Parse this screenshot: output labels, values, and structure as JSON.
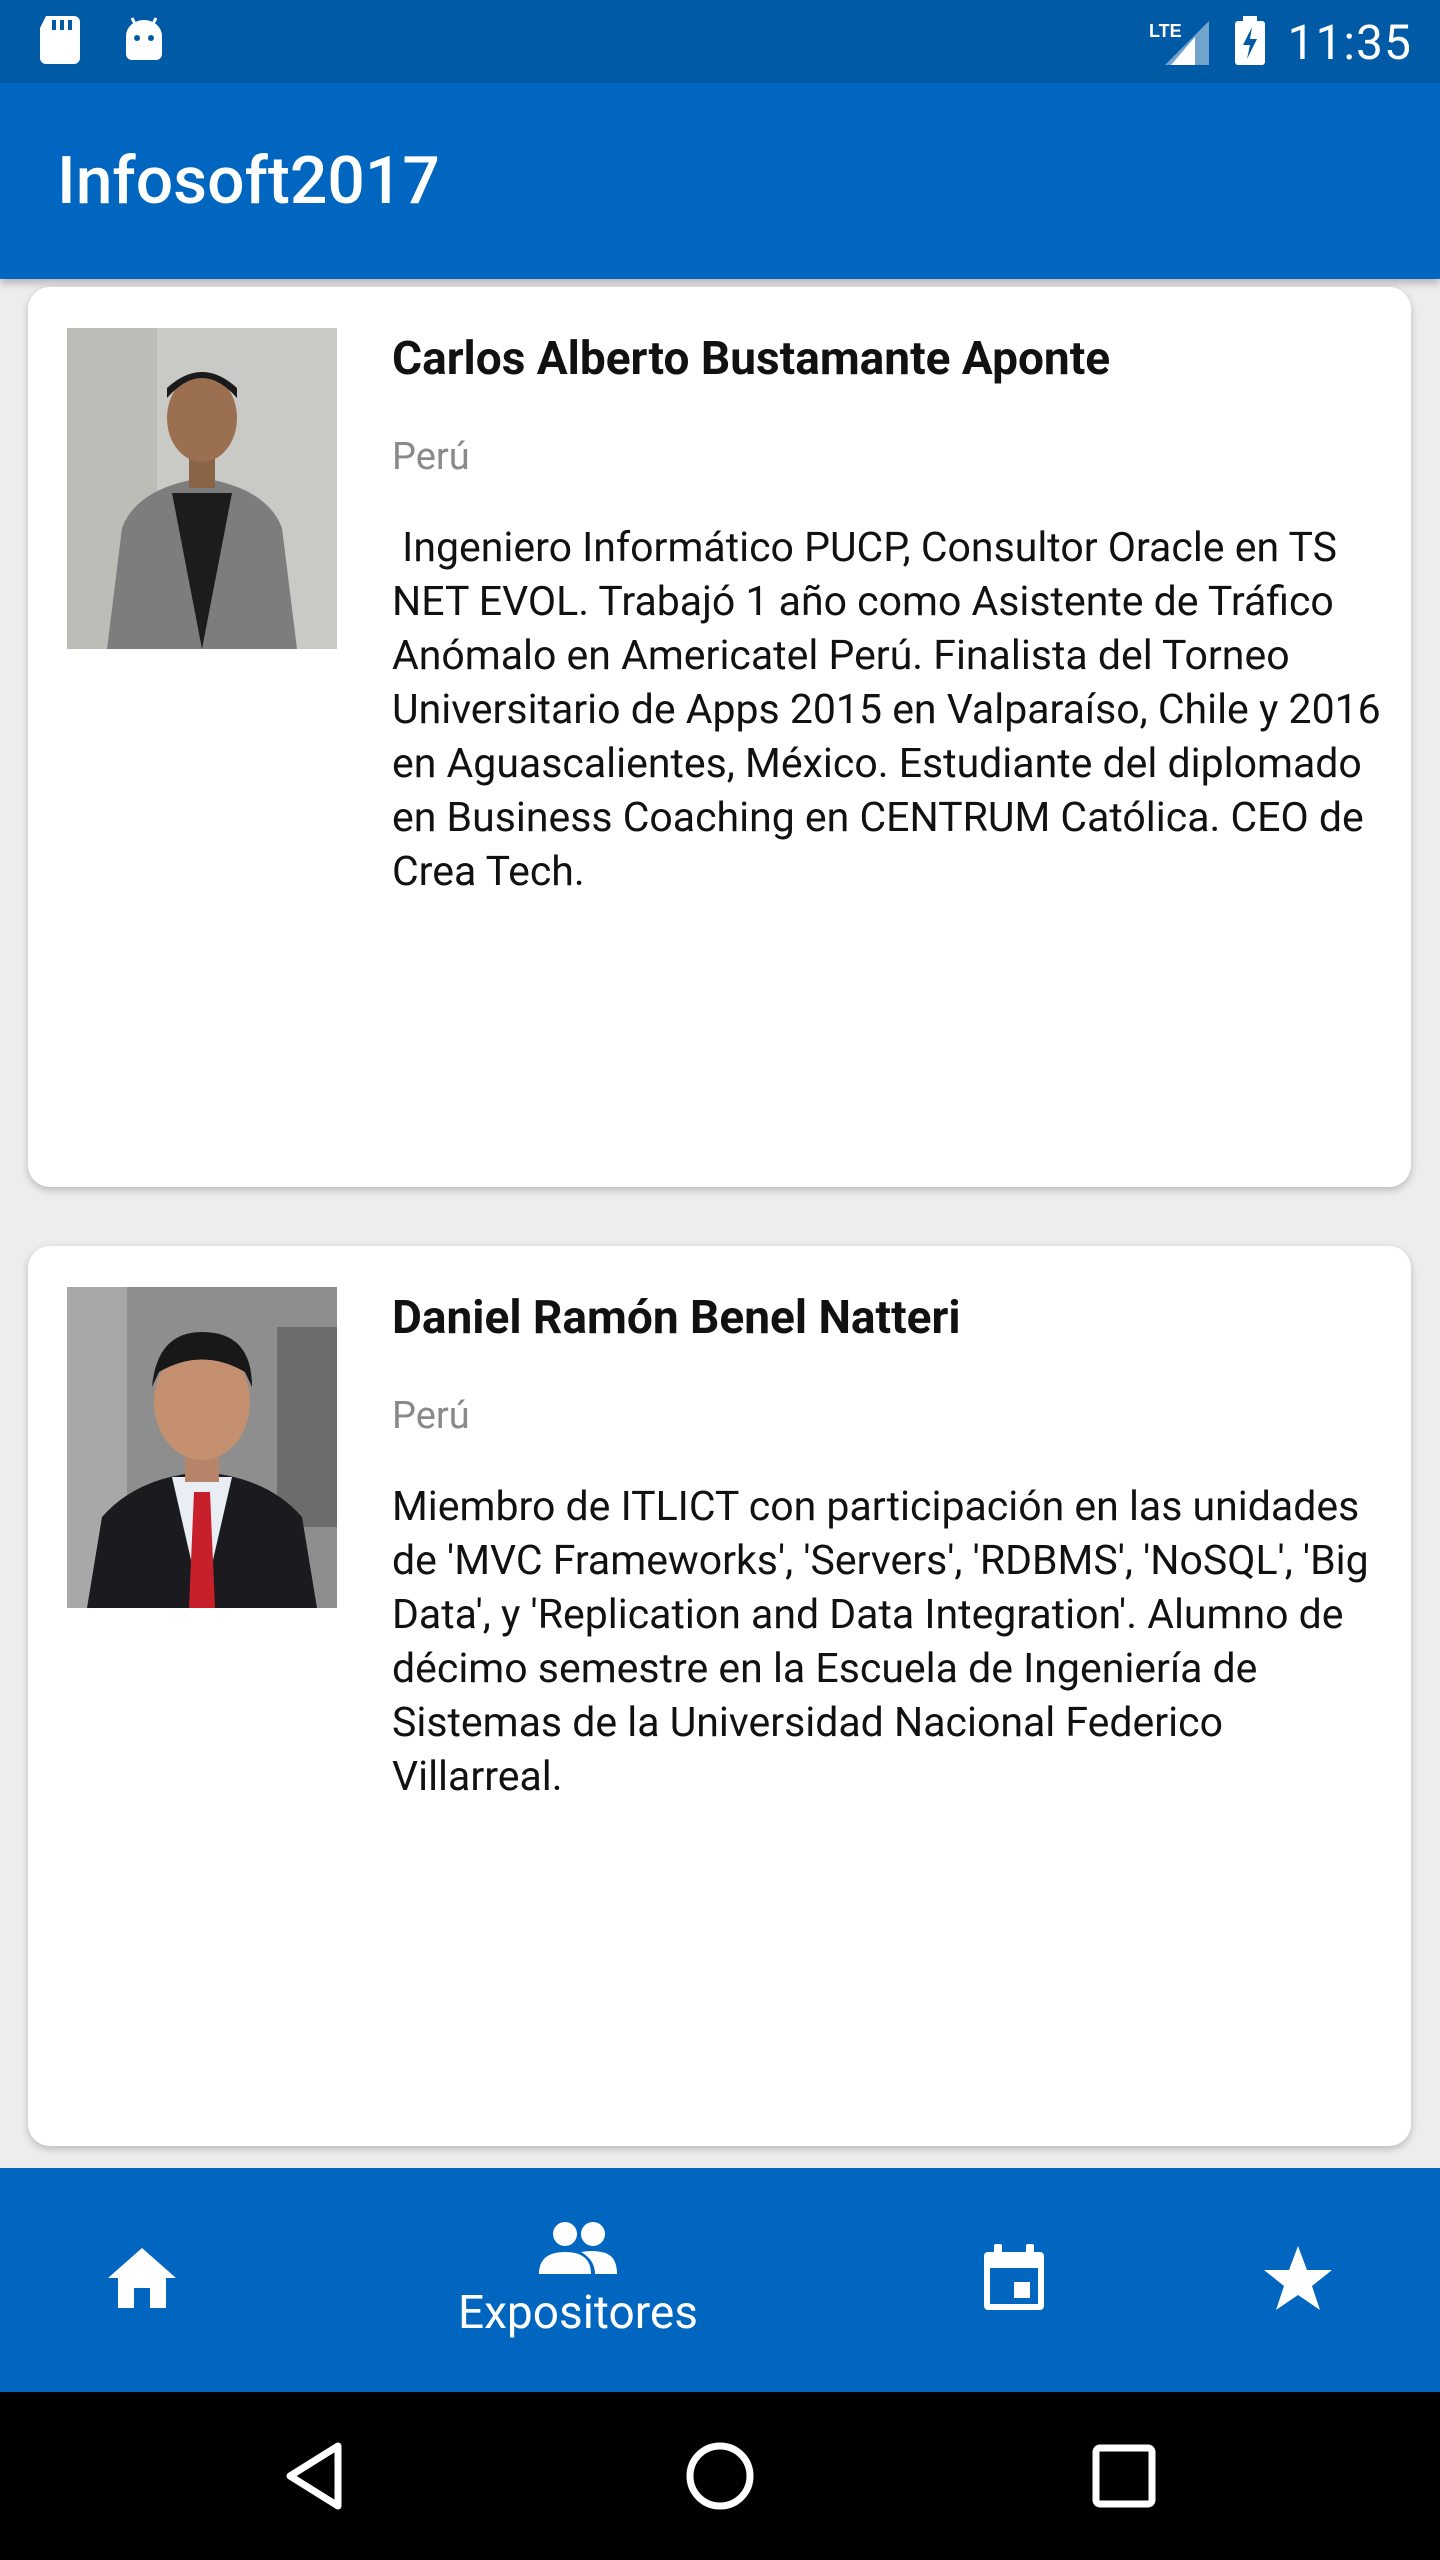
{
  "status_bar": {
    "time": "11:35",
    "network": "LTE",
    "icons": [
      "sd-card-icon",
      "android-icon",
      "lte-signal-icon",
      "battery-charging-icon"
    ]
  },
  "app_bar": {
    "title": "Infosoft2017"
  },
  "speakers": [
    {
      "name": "Carlos Alberto Bustamante Aponte",
      "country": "Perú",
      "bio": " Ingeniero Informático PUCP, Consultor Oracle en TS NET EVOL. Trabajó 1 año como Asistente de Tráfico Anómalo en Americatel Perú. Finalista del Torneo Universitario de Apps 2015 en Valparaíso, Chile y 2016 en Aguascalientes, México. Estudiante del diplomado en Business Coaching en CENTRUM Católica. CEO de Crea Tech."
    },
    {
      "name": "Daniel Ramón Benel Natteri",
      "country": "Perú",
      "bio": "Miembro de ITLICT con participación en las unidades de 'MVC Frameworks', 'Servers', 'RDBMS', 'NoSQL', 'Big Data', y 'Replication and Data Integration'. Alumno de décimo semestre en la Escuela de Ingeniería de Sistemas de la Universidad Nacional Federico Villarreal."
    }
  ],
  "bottom_nav": {
    "items": [
      {
        "icon": "home-icon",
        "label": ""
      },
      {
        "icon": "people-icon",
        "label": "Expositores"
      },
      {
        "icon": "calendar-icon",
        "label": ""
      },
      {
        "icon": "star-icon",
        "label": ""
      }
    ],
    "active_index": 1
  },
  "colors": {
    "primary": "#0066bf",
    "status_bar": "#005aa6",
    "background": "#ededed"
  }
}
